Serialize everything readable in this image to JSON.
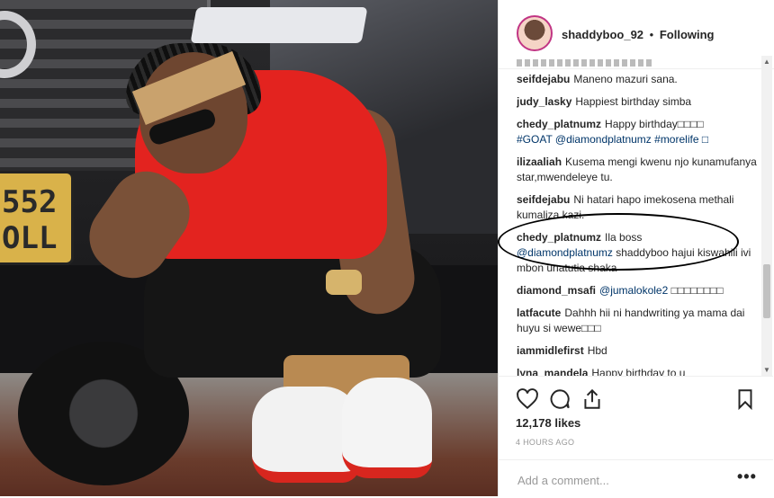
{
  "photo": {
    "plate_line1": "552",
    "plate_line2": "OLL"
  },
  "header": {
    "username": "shaddyboo_92",
    "separator": "•",
    "follow_status": "Following"
  },
  "comments": [
    {
      "user": "",
      "text": "",
      "faded": true
    },
    {
      "user": "seifdejabu",
      "text": "Maneno mazuri sana."
    },
    {
      "user": "judy_lasky",
      "text": "Happiest birthday simba"
    },
    {
      "user": "chedy_platnumz",
      "text": "Happy birthday□□□□",
      "mention": "#GOAT @diamondplatnumz #morelife □"
    },
    {
      "user": "ilizaaliah",
      "text": "Kusema mengi kwenu njo kunamufanya star,mwendeleye tu."
    },
    {
      "user": "seifdejabu",
      "text": "Ni hatari hapo imekosena methali kumaliza kazi."
    },
    {
      "user": "chedy_platnumz",
      "text": "Ila boss",
      "mention": "@diamondplatnumz",
      "text2": "shaddyboo hajui kiswahili ivi mbon unatutia shaka"
    },
    {
      "user": "diamond_msafi",
      "mention": "@jumalokole2",
      "text2": "□□□□□□□□"
    },
    {
      "user": "latfacute",
      "text": "Dahhh hii ni handwriting ya mama dai huyu si wewe□□□"
    },
    {
      "user": "iammidlefirst",
      "text": "Hbd"
    },
    {
      "user": "lyna_mandela",
      "text": "Happy birthday to u"
    }
  ],
  "actions": {
    "icons": [
      "heart-icon",
      "comment-icon",
      "share-icon",
      "bookmark-icon"
    ],
    "likes": "12,178 likes",
    "time": "4 HOURS AGO",
    "comment_placeholder": "Add a comment...",
    "more": "•••"
  }
}
